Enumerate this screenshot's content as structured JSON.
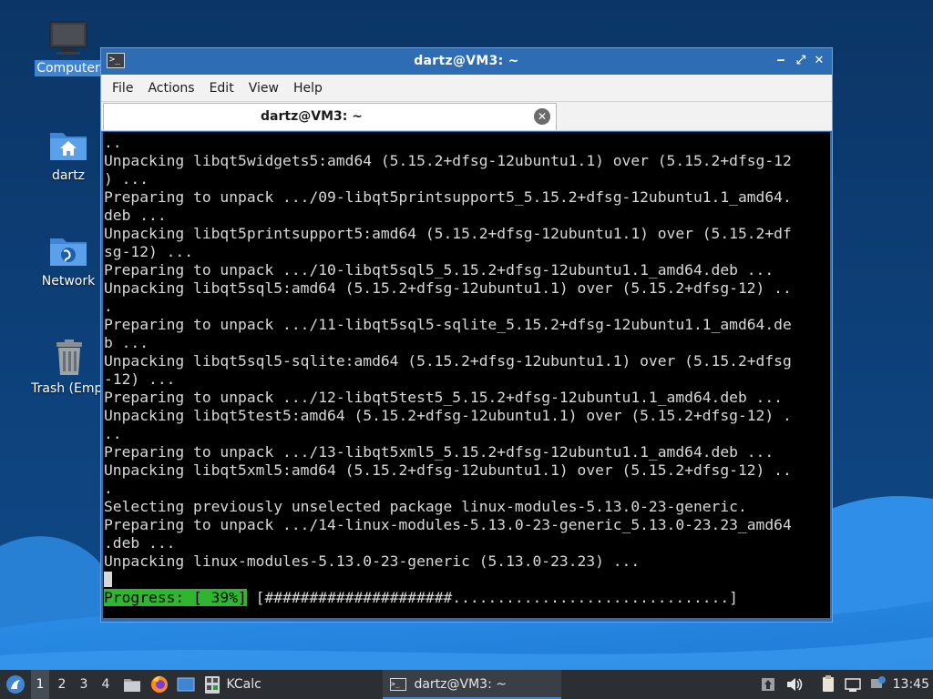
{
  "desktop": {
    "icons": [
      {
        "label": "Computer",
        "icon": "computer-icon"
      },
      {
        "label": "dartz",
        "icon": "home-folder-icon"
      },
      {
        "label": "Network",
        "icon": "network-folder-icon"
      },
      {
        "label": "Trash (Empt",
        "icon": "trash-icon"
      }
    ]
  },
  "window": {
    "title": "dartz@VM3: ~",
    "controls": {
      "minimize": "‒",
      "maximize": "⤢",
      "close": "✕"
    },
    "menu": [
      "File",
      "Actions",
      "Edit",
      "View",
      "Help"
    ],
    "tab": {
      "label": "dartz@VM3: ~",
      "close": "✕"
    }
  },
  "terminal": {
    "lines": [
      "..",
      "Unpacking libqt5widgets5:amd64 (5.15.2+dfsg-12ubuntu1.1) over (5.15.2+dfsg-12",
      ") ...",
      "Preparing to unpack .../09-libqt5printsupport5_5.15.2+dfsg-12ubuntu1.1_amd64.",
      "deb ...",
      "Unpacking libqt5printsupport5:amd64 (5.15.2+dfsg-12ubuntu1.1) over (5.15.2+df",
      "sg-12) ...",
      "Preparing to unpack .../10-libqt5sql5_5.15.2+dfsg-12ubuntu1.1_amd64.deb ...",
      "Unpacking libqt5sql5:amd64 (5.15.2+dfsg-12ubuntu1.1) over (5.15.2+dfsg-12) ..",
      ".",
      "Preparing to unpack .../11-libqt5sql5-sqlite_5.15.2+dfsg-12ubuntu1.1_amd64.de",
      "b ...",
      "Unpacking libqt5sql5-sqlite:amd64 (5.15.2+dfsg-12ubuntu1.1) over (5.15.2+dfsg",
      "-12) ...",
      "Preparing to unpack .../12-libqt5test5_5.15.2+dfsg-12ubuntu1.1_amd64.deb ...",
      "Unpacking libqt5test5:amd64 (5.15.2+dfsg-12ubuntu1.1) over (5.15.2+dfsg-12) .",
      "..",
      "Preparing to unpack .../13-libqt5xml5_5.15.2+dfsg-12ubuntu1.1_amd64.deb ...",
      "Unpacking libqt5xml5:amd64 (5.15.2+dfsg-12ubuntu1.1) over (5.15.2+dfsg-12) ..",
      ".",
      "Selecting previously unselected package linux-modules-5.13.0-23-generic.",
      "Preparing to unpack .../14-linux-modules-5.13.0-23-generic_5.13.0-23.23_amd64",
      ".deb ...",
      "Unpacking linux-modules-5.13.0-23-generic (5.13.0-23.23) ..."
    ],
    "progress_label": "Progress: [ 39%]",
    "progress_bar": "[#####################...............................]",
    "progress_percent": 39
  },
  "taskbar": {
    "workspaces": [
      "1",
      "2",
      "3",
      "4"
    ],
    "active_workspace": "1",
    "kcalc_label": "KCalc",
    "terminal_task_label": "dartz@VM3: ~",
    "clock": "13:45"
  },
  "colors": {
    "accent": "#3f85d4",
    "progress_green": "#2fb52f",
    "terminal_bg": "#000000",
    "window_frame": "#2e6cb3"
  }
}
